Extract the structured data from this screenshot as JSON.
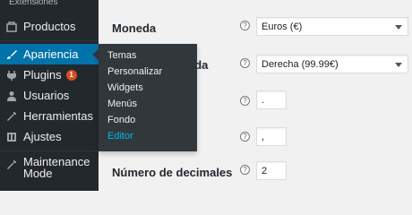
{
  "sidebar": {
    "top_label": "Extensiones",
    "items": [
      {
        "label": "Productos"
      },
      {
        "label": "Apariencia"
      },
      {
        "label": "Plugins",
        "badge": "1"
      },
      {
        "label": "Usuarios"
      },
      {
        "label": "Herramientas"
      },
      {
        "label": "Ajustes"
      },
      {
        "label": "Maintenance Mode"
      }
    ]
  },
  "flyout": {
    "items": [
      "Temas",
      "Personalizar",
      "Widgets",
      "Menús",
      "Fondo",
      "Editor"
    ],
    "current": "Editor"
  },
  "settings": {
    "moneda": {
      "label": "Moneda",
      "value": "Euros (€)"
    },
    "posicion": {
      "label_partial": "eda",
      "value": "Derecha (99.99€)"
    },
    "sep_miles": {
      "value": "."
    },
    "sep_decimal": {
      "value": ","
    },
    "decimales": {
      "label": "Número de decimales",
      "value": "2"
    },
    "help_glyph": "?"
  },
  "colors": {
    "sidebar_bg": "#23282d",
    "active_bg": "#0073aa",
    "flyout_bg": "#32373c",
    "current_link": "#00b9eb",
    "badge": "#d54e21"
  }
}
